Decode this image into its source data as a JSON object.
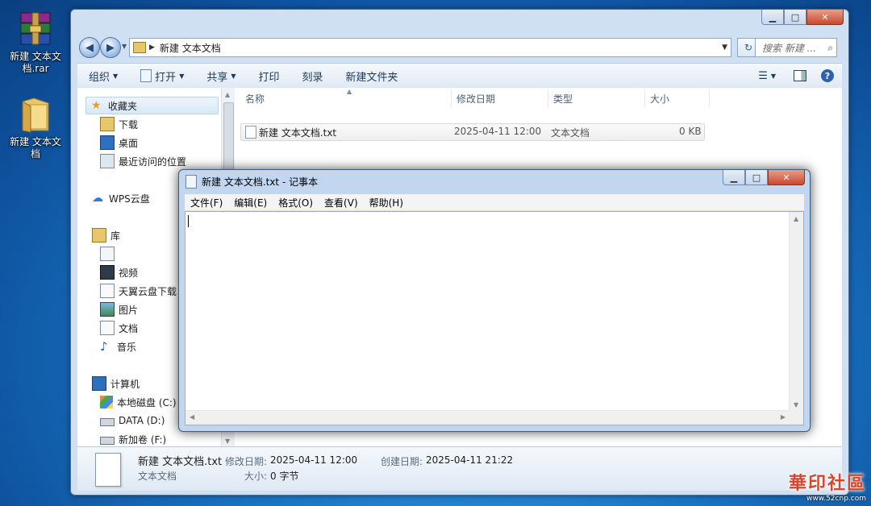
{
  "desktop": {
    "icons": [
      {
        "label": "新建 文本文档.rar"
      },
      {
        "label": "新建 文本文档"
      }
    ]
  },
  "explorer": {
    "title_buttons": {
      "minimize": "▁",
      "maximize": "□",
      "close": "✕"
    },
    "breadcrumb": "新建 文本文档",
    "search_placeholder": "搜索 新建 ...",
    "toolbar": {
      "organize": "组织",
      "open": "打开",
      "share": "共享",
      "print": "打印",
      "burn": "刻录",
      "new_folder": "新建文件夹"
    },
    "nav": {
      "favorites": "收藏夹",
      "downloads": "下载",
      "desktop": "桌面",
      "recent": "最近访问的位置",
      "wps": "WPS云盘",
      "library": "库",
      "video": "视频",
      "tianyi": "天翼云盘下载",
      "pictures": "图片",
      "documents": "文档",
      "music": "音乐",
      "computer": "计算机",
      "drive_c": "本地磁盘 (C:)",
      "drive_d": "DATA (D:)",
      "drive_f": "新加卷 (F:)"
    },
    "columns": {
      "name": "名称",
      "modified": "修改日期",
      "type": "类型",
      "size": "大小"
    },
    "files": [
      {
        "name": "新建 文本文档.txt",
        "modified": "2025-04-11 12:00",
        "type": "文本文档",
        "size": "0 KB"
      }
    ],
    "details": {
      "filename": "新建 文本文档.txt",
      "filetype": "文本文档",
      "modified_label": "修改日期:",
      "modified_value": "2025-04-11 12:00",
      "created_label": "创建日期:",
      "created_value": "2025-04-11 21:22",
      "size_label": "大小:",
      "size_value": "0 字节"
    }
  },
  "notepad": {
    "title": "新建 文本文档.txt - 记事本",
    "menu": [
      "文件(F)",
      "编辑(E)",
      "格式(O)",
      "查看(V)",
      "帮助(H)"
    ],
    "content": ""
  },
  "watermark": {
    "text": "華印社區",
    "url": "www.52cnp.com"
  },
  "colors": {
    "accent": "#1e5fa8",
    "close_button": "#c74a2e",
    "frame": "#cfe0f2"
  }
}
